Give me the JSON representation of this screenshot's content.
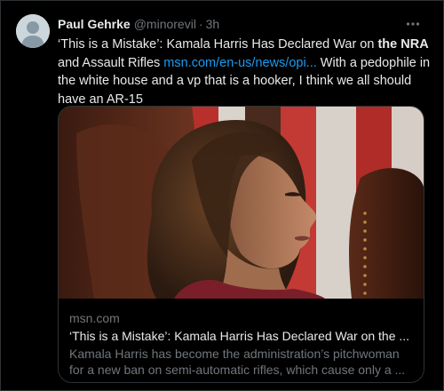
{
  "post": {
    "author_name": "Paul Gehrke",
    "author_handle": "@minorevil",
    "separator": "·",
    "timestamp": "3h",
    "text_part1": "‘This is a Mistake’: Kamala Harris Has Declared War on ",
    "text_bold": "the NRA",
    "text_part2": " and Assault Rifles ",
    "link_text": "msn.com/en-us/news/opi...",
    "text_part3": " With a pedophile in the white house and a vp that is a hooker, I think we all should have an AR-15"
  },
  "link_card": {
    "domain": "msn.com",
    "title": "‘This is a Mistake’: Kamala Harris Has Declared War on the ...",
    "description": "Kamala Harris has become the administration’s pitchwoman for a new ban on semi-automatic rifles, which cause only a ..."
  },
  "icons": {
    "avatar": "default-avatar-icon",
    "more": "more-options-icon"
  },
  "colors": {
    "background": "#000000",
    "text_primary": "#e7e9ea",
    "text_secondary": "#71767b",
    "link": "#1d9bf0",
    "border": "#2f3336"
  }
}
